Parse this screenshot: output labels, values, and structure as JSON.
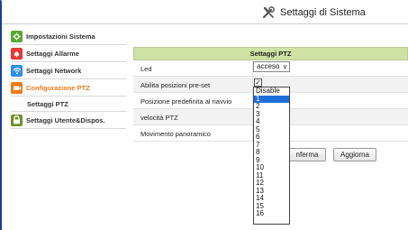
{
  "header": {
    "title": "Settaggi di Sistema",
    "icon": "tools-icon"
  },
  "sidebar": {
    "items": [
      {
        "label": "Impostazioni Sistema",
        "icon": "settings-icon",
        "color": "#5aa832"
      },
      {
        "label": "Settaggi Allarme",
        "icon": "alarm-bell-icon",
        "color": "#e53935"
      },
      {
        "label": "Settaggi Network",
        "icon": "wifi-icon",
        "color": "#2f8de4"
      },
      {
        "label": "Configurazione PTZ",
        "icon": "ptz-camera-icon",
        "color": "#f07a1a"
      },
      {
        "label": "Settaggi PTZ",
        "icon": "",
        "color": ""
      },
      {
        "label": "Settaggi Utente&Dispos.",
        "icon": "user-lock-icon",
        "color": "#6d8f2a"
      }
    ]
  },
  "panel": {
    "title": "Settaggi PTZ",
    "rows": [
      {
        "label": "Led"
      },
      {
        "label": "Abilita posizioni pre-set"
      },
      {
        "label": "Posizione predefinita al riavvio"
      },
      {
        "label": "velocità PTZ"
      },
      {
        "label": "Movimento panoramico"
      }
    ],
    "led_value": "acceso",
    "preset_checked": "✓"
  },
  "dropdown": {
    "options": [
      "Disable",
      "1",
      "2",
      "3",
      "4",
      "5",
      "6",
      "7",
      "8",
      "9",
      "10",
      "11",
      "12",
      "13",
      "14",
      "15",
      "16"
    ],
    "selected_index": 1
  },
  "buttons": {
    "confirm": "nferma",
    "refresh": "Aggiorna"
  },
  "colors": {
    "panel_header": "#cde2a3",
    "active_nav": "#f07a1a",
    "frame_border": "#1a3f8f",
    "selected_option": "#1e6fd9"
  }
}
